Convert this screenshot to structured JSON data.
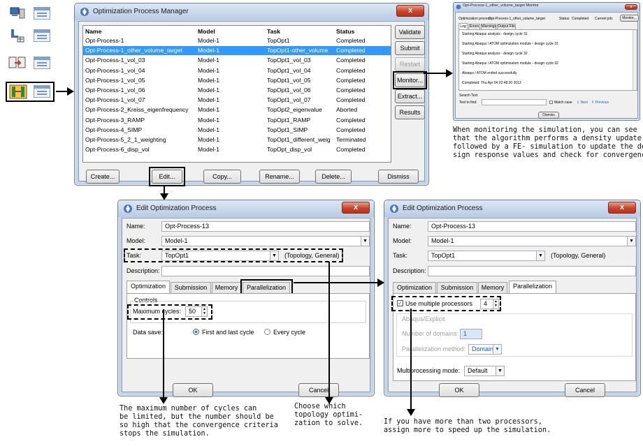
{
  "manager": {
    "title": "Optimization Process Manager",
    "columns": [
      "Name",
      "Model",
      "Task",
      "Status"
    ],
    "rows": [
      {
        "name": "Opt-Process-1",
        "model": "Model-1",
        "task": "TopOpt1",
        "status": "Completed"
      },
      {
        "name": "Opt-Process-1_other_volume_target",
        "model": "Model-1",
        "task": "TopOpt1-other_volume",
        "status": "Completed"
      },
      {
        "name": "Opt-Process-1_vol_03",
        "model": "Model-1",
        "task": "TopOpt1_vol_03",
        "status": "Completed"
      },
      {
        "name": "Opt-Process-1_vol_04",
        "model": "Model-1",
        "task": "TopOpt1_vol_04",
        "status": "Completed"
      },
      {
        "name": "Opt-Process-1_vol_05",
        "model": "Model-1",
        "task": "TopOpt1_vol_05",
        "status": "Completed"
      },
      {
        "name": "Opt-Process-1_vol_06",
        "model": "Model-1",
        "task": "TopOpt1_vol_06",
        "status": "Completed"
      },
      {
        "name": "Opt-Process-1_vol_07",
        "model": "Model-1",
        "task": "TopOpt1_vol_07",
        "status": "Completed"
      },
      {
        "name": "Opt-Process-2_Kreiss_eigenfrequency",
        "model": "Model-1",
        "task": "TopOpt2_eigenvalue",
        "status": "Aborted"
      },
      {
        "name": "Opt-Process-3_RAMP",
        "model": "Model-1",
        "task": "TopOpt1_RAMP",
        "status": "Completed"
      },
      {
        "name": "Opt-Process-4_SIMP",
        "model": "Model-1",
        "task": "TopOpt1_SIMP",
        "status": "Completed"
      },
      {
        "name": "Opt-Process-5_2_1_weighting",
        "model": "Model-1",
        "task": "TopOpt1_different_weig",
        "status": "Terminated"
      },
      {
        "name": "Opt-Process-6_disp_vol",
        "model": "Model-1",
        "task": "TopOpt_disp_vol",
        "status": "Completed"
      }
    ],
    "side_buttons": [
      "Validate",
      "Submit",
      "Restart",
      "Monitor...",
      "Extract...",
      "Results"
    ],
    "bottom_buttons": [
      "Create...",
      "Edit...",
      "Copy...",
      "Rename...",
      "Delete...",
      "Dismiss"
    ],
    "close_label": "x"
  },
  "monitor": {
    "title": "Opt-Process-1_other_volume_target Monitor",
    "process_label": "Optimization process:",
    "process_value": "Opt-Process-1_other_volume_target",
    "status_label": "Status:",
    "status_value": "Completed",
    "current_job_label": "Current job:",
    "monitor_btn": "Monitor...",
    "tabs": [
      "Log",
      "Errors",
      "Warnings",
      "Output File"
    ],
    "log_lines": [
      "Starting Abaqus analysis - design cycle 31",
      "Starting Abaqus / ATOM optimization module - design cycle 31",
      "Starting Abaqus analysis - design cycle 32",
      "Starting Abaqus / ATOM optimization module - design cycle 32",
      "Abaqus / ATOM ended successfully",
      "Completed: Thu Apr 04 22:48:20 2013"
    ],
    "search_label": "Search Text",
    "find_label": "Text to find:",
    "match_case": "Match case",
    "next": "Next",
    "previous": "Previous",
    "dismiss": "Dismiss"
  },
  "edit1": {
    "title": "Edit Optimization Process",
    "name_label": "Name:",
    "name_value": "Opt-Process-13",
    "model_label": "Model:",
    "model_value": "Model-1",
    "task_label": "Task:",
    "task_value": "TopOpt1",
    "task_note": "(Topology, General)",
    "desc_label": "Description:",
    "tabs": [
      "Optimization",
      "Submission",
      "Memory",
      "Parallelization"
    ],
    "controls_label": "Controls",
    "max_cycles_label": "Maximum cycles:",
    "max_cycles_value": "50",
    "data_save_label": "Data save:",
    "radio_first_last": "First and last cycle",
    "radio_every": "Every cycle",
    "ok": "OK",
    "cancel": "Cancel"
  },
  "edit2": {
    "title": "Edit Optimization Process",
    "name_label": "Name:",
    "name_value": "Opt-Process-13",
    "model_label": "Model:",
    "model_value": "Model-1",
    "task_label": "Task:",
    "task_value": "TopOpt1",
    "task_note": "(Topology, General)",
    "desc_label": "Description:",
    "tabs": [
      "Optimization",
      "Submission",
      "Memory",
      "Parallelization"
    ],
    "use_multi": "Use multiple processors",
    "procs_value": "4",
    "abaqus_explicit": "Abaqus/Explicit",
    "domains_label": "Number of domains:",
    "domains_value": "1",
    "par_method_label": "Parallelization method:",
    "par_method_value": "Domain",
    "multiproc_label": "Multiprocessing mode:",
    "multiproc_value": "Default",
    "ok": "OK",
    "cancel": "Cancel"
  },
  "captions": {
    "monitor_note": [
      "When monitoring the simulation, you can see",
      "that the algorithm performs a density update",
      "followed by a FE- simulation to update the de-",
      "sign response values and check for convergence."
    ],
    "cycles_note": [
      "The maximum number of cycles can",
      "be limited, but the number should be",
      "so high that the convergence criteria",
      "stops the simulation."
    ],
    "topology_note": [
      "Choose which",
      "topology optimi-",
      "zation to solve."
    ],
    "processors_note": [
      "If you have more than two processors,",
      "assign more to speed up the simulation."
    ]
  },
  "colors": {
    "selection": "#3399ff",
    "title_gradient_top": "#dce7f5",
    "close_red": "#c7442a"
  }
}
